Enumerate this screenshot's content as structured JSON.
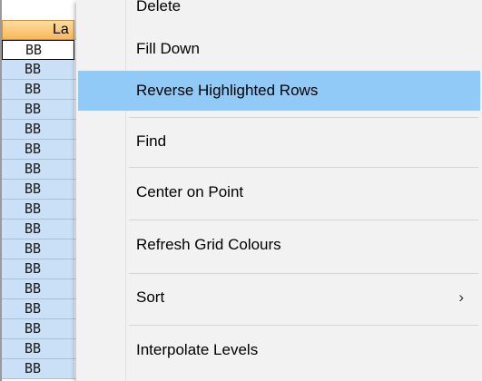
{
  "grid": {
    "header_label": "La",
    "edit_value": "BB",
    "rows": [
      "BB",
      "BB",
      "BB",
      "BB",
      "BB",
      "BB",
      "BB",
      "BB",
      "BB",
      "BB",
      "BB",
      "BB",
      "BB",
      "BB",
      "BB"
    ]
  },
  "menu": {
    "items": [
      {
        "label": "Delete"
      },
      {
        "label": "Fill Down"
      },
      {
        "label": "Reverse Highlighted Rows",
        "highlighted": true
      },
      {
        "label": "Find"
      },
      {
        "label": "Center on Point"
      },
      {
        "label": "Refresh Grid Colours"
      },
      {
        "label": "Sort",
        "submenu_arrow": "›"
      },
      {
        "label": "Interpolate Levels"
      }
    ]
  }
}
